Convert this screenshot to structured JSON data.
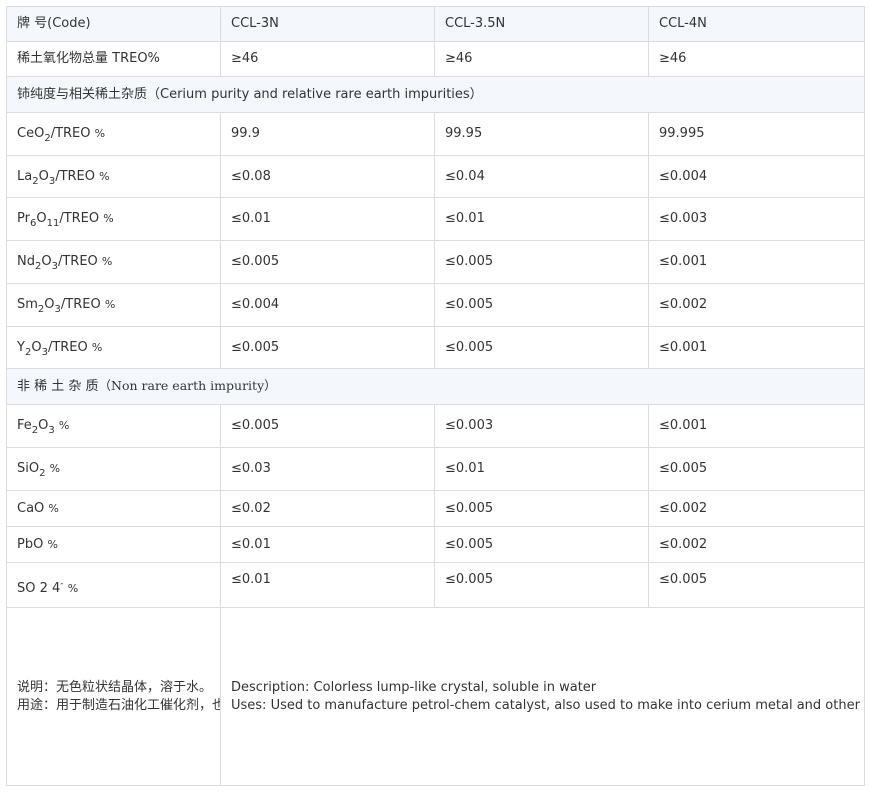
{
  "header": {
    "code_label": "牌 号(Code)",
    "grades": [
      "CCL-3N",
      "CCL-3.5N",
      "CCL-4N"
    ]
  },
  "treo_row": {
    "label": "稀土氧化物总量 TREO%",
    "values": [
      "≥46",
      "≥46",
      "≥46"
    ]
  },
  "section_re": {
    "title": "铈纯度与相关稀土杂质（Cerium purity and relative rare earth impurities）"
  },
  "rows_re": [
    {
      "formula": "CeO₂/TREO %",
      "values": [
        "99.9",
        "99.95",
        "99.995"
      ]
    },
    {
      "formula": "La₂O₃/TREO %",
      "values": [
        "≤0.08",
        "≤0.04",
        "≤0.004"
      ]
    },
    {
      "formula": "Pr₆O₁₁/TREO %",
      "values": [
        "≤0.01",
        "≤0.01",
        "≤0.003"
      ]
    },
    {
      "formula": "Nd₂O₃/TREO %",
      "values": [
        "≤0.005",
        "≤0.005",
        "≤0.001"
      ]
    },
    {
      "formula": "Sm₂O₃/TREO %",
      "values": [
        "≤0.004",
        "≤0.005",
        "≤0.002"
      ]
    },
    {
      "formula": "Y₂O₃/TREO %",
      "values": [
        "≤0.005",
        "≤0.005",
        "≤0.001"
      ]
    }
  ],
  "section_non": {
    "title_cn": "非 稀 土 杂 质",
    "title_en": "（Non rare earth impurity）"
  },
  "rows_non": [
    {
      "formula": "Fe₂O₃ %",
      "values": [
        "≤0.005",
        "≤0.003",
        "≤0.001"
      ]
    },
    {
      "formula": "SiO₂ %",
      "values": [
        "≤0.03",
        "≤0.01",
        "≤0.005"
      ]
    },
    {
      "formula": "CaO %",
      "values": [
        "≤0.02",
        "≤0.005",
        "≤0.002"
      ]
    },
    {
      "formula": "PbO %",
      "values": [
        "≤0.01",
        "≤0.005",
        "≤0.002"
      ]
    },
    {
      "formula": "SO 2 4⁻ %",
      "values": [
        "≤0.01",
        "≤0.005",
        "≤0.005"
      ]
    }
  ],
  "notes": {
    "cn_description": "说明：无色粒状结晶体，溶于水。",
    "cn_usage": "用途：用于制造石油化工催化剂，也可用来制造金属铈和铈的其它化合物。",
    "en_description": "Description: Colorless lump-like crystal, soluble in water",
    "en_usage": "Uses: Used to manufacture petrol-chem catalyst, also used to make into cerium metal and other compounds of cerium."
  }
}
